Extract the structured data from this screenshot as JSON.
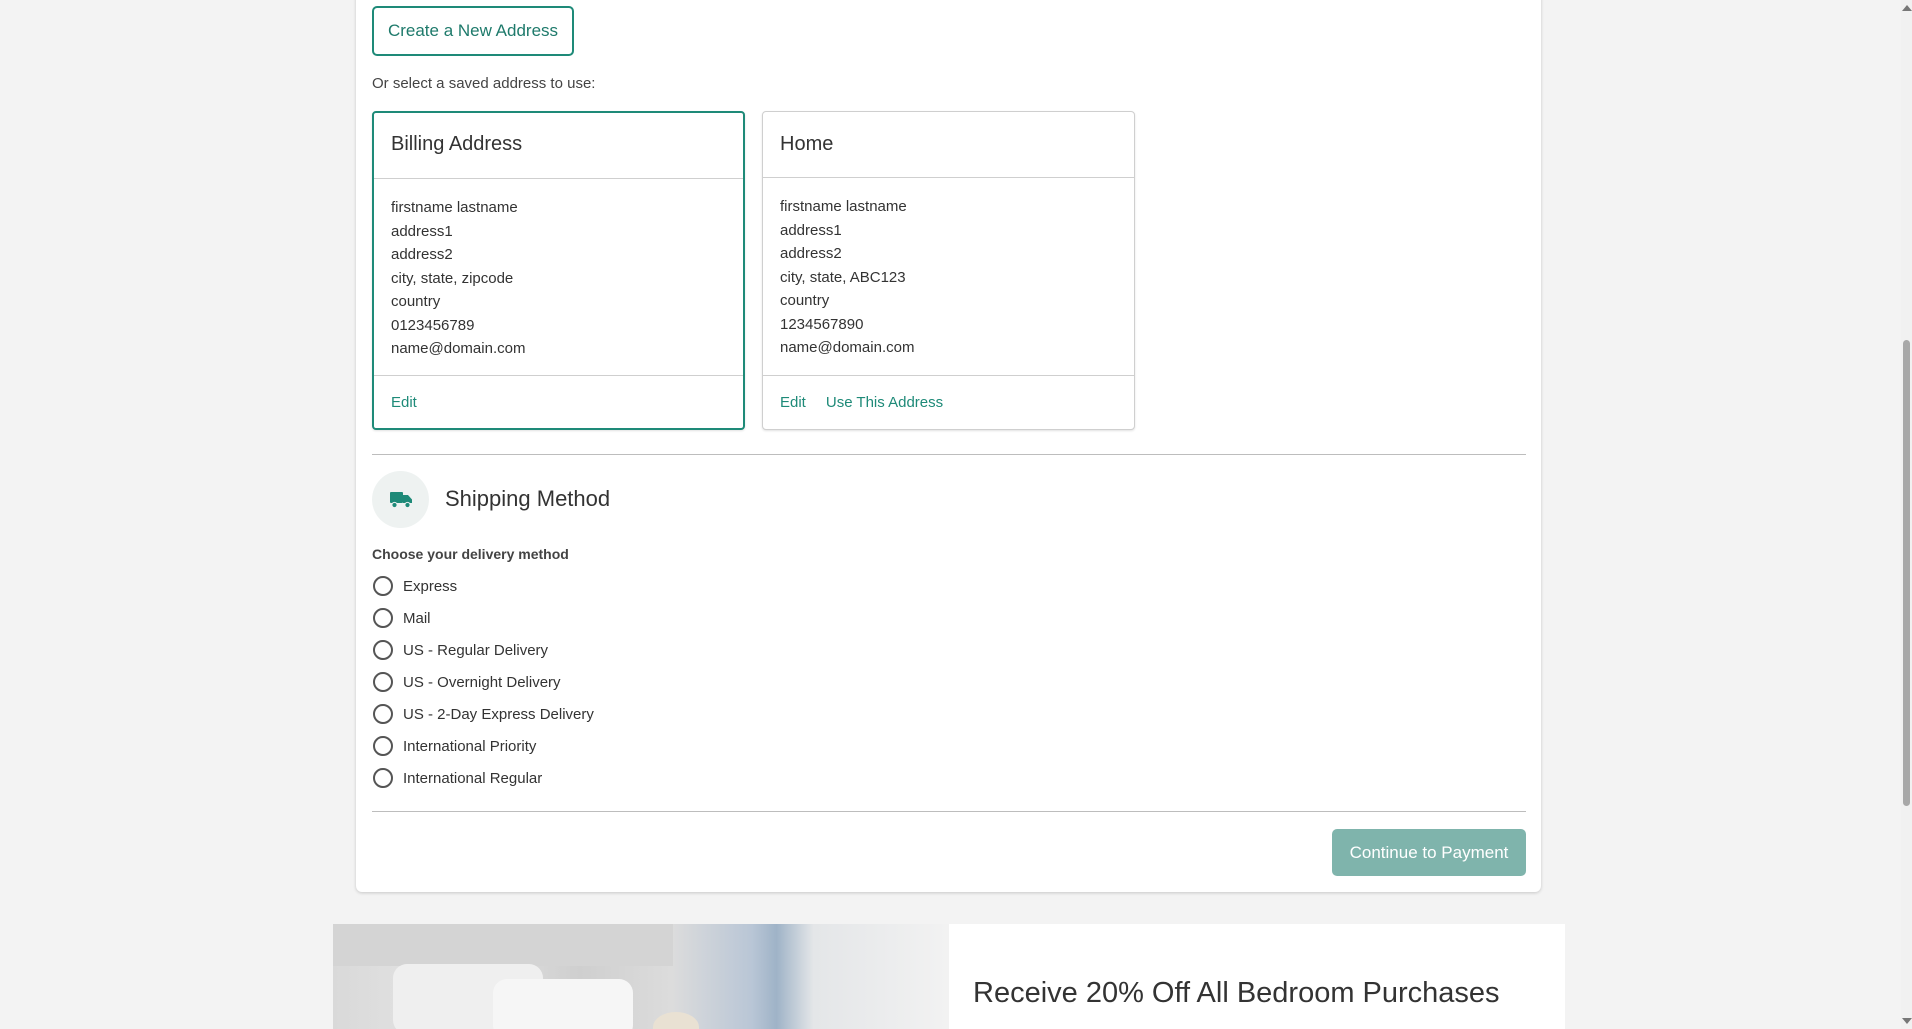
{
  "address": {
    "create_button": "Create a New Address",
    "saved_label": "Or select a saved address to use:",
    "cards": [
      {
        "title": "Billing Address",
        "lines": [
          "firstname lastname",
          "address1",
          "address2",
          "city, state, zipcode",
          "country",
          "0123456789",
          "name@domain.com"
        ],
        "edit": "Edit",
        "selected": true
      },
      {
        "title": "Home",
        "lines": [
          "firstname lastname",
          "address1",
          "address2",
          "city, state, ABC123",
          "country",
          "1234567890",
          "name@domain.com"
        ],
        "edit": "Edit",
        "use": "Use This Address",
        "selected": false
      }
    ]
  },
  "shipping": {
    "icon": "truck-icon",
    "title": "Shipping Method",
    "choose_label": "Choose your delivery method",
    "options": [
      "Express",
      "Mail",
      "US - Regular Delivery",
      "US - Overnight Delivery",
      "US - 2-Day Express Delivery",
      "International Priority",
      "International Regular"
    ]
  },
  "continue_button": "Continue to Payment",
  "promo": {
    "title": "Receive 20% Off All Bedroom Purchases"
  },
  "colors": {
    "accent": "#1e8a78",
    "button_disabled": "#7fb4ac"
  }
}
